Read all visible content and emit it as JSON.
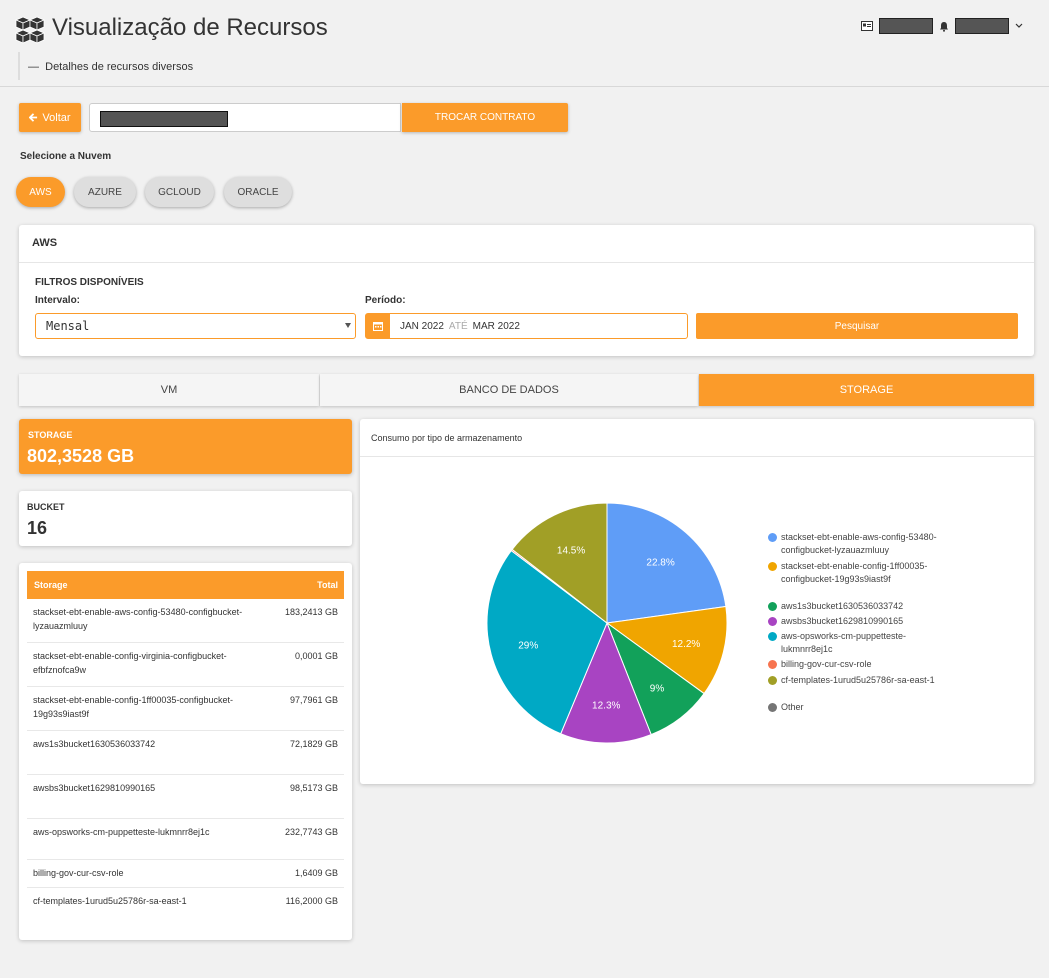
{
  "header": {
    "title": "Visualização de Recursos",
    "subtitle": "Detalhes de recursos diversos",
    "subtitle_dash": "—"
  },
  "contract": {
    "back_label": "Voltar",
    "switch_label": "TROCAR CONTRATO"
  },
  "cloud": {
    "label": "Selecione a Nuvem",
    "options": [
      "AWS",
      "AZURE",
      "GCLOUD",
      "ORACLE"
    ],
    "selected": "AWS"
  },
  "filters": {
    "card_title": "AWS",
    "section_title": "FILTROS DISPONÍVEIS",
    "interval_label": "Intervalo:",
    "interval_value": "Mensal",
    "period_label": "Período:",
    "period_start": "JAN 2022",
    "period_sep": "ATÉ",
    "period_end": "MAR 2022",
    "search_label": "Pesquisar"
  },
  "tabs": [
    "VM",
    "BANCO DE DADOS",
    "STORAGE"
  ],
  "active_tab": "STORAGE",
  "metrics": {
    "storage_label": "STORAGE",
    "storage_value": "802,3528 GB",
    "bucket_label": "BUCKET",
    "bucket_value": "16"
  },
  "table": {
    "col_storage": "Storage",
    "col_total": "Total",
    "rows": [
      {
        "name": "stackset-ebt-enable-aws-config-53480-configbucket-lyzauazmluuy",
        "total": "183,2413 GB"
      },
      {
        "name": "stackset-ebt-enable-config-virginia-configbucket-efbfznofca9w",
        "total": "0,0001 GB"
      },
      {
        "name": "stackset-ebt-enable-config-1ff00035-configbucket-19g93s9iast9f",
        "total": "97,7961 GB"
      },
      {
        "name": "aws1s3bucket1630536033742",
        "total": "72,1829 GB"
      },
      {
        "name": "awsbs3bucket1629810990165",
        "total": "98,5173 GB"
      },
      {
        "name": "aws-opsworks-cm-puppetteste-lukmnrr8ej1c",
        "total": "232,7743 GB"
      },
      {
        "name": "billing-gov-cur-csv-role",
        "total": "1,6409 GB"
      },
      {
        "name": "cf-templates-1urud5u25786r-sa-east-1",
        "total": "116,2000 GB"
      }
    ]
  },
  "chart_data": {
    "type": "pie",
    "title": "Consumo por tipo de armazenamento",
    "legend_position": "right",
    "slices": [
      {
        "label": "stackset-ebt-enable-aws-config-53480-configbucket-lyzauazmluuy",
        "value": 22.8,
        "text": "22.8%",
        "color": "#5f9df7"
      },
      {
        "label": "stackset-ebt-enable-config-1ff00035-configbucket-19g93s9iast9f",
        "value": 12.2,
        "text": "12.2%",
        "color": "#f0a500"
      },
      {
        "label": "aws1s3bucket1630536033742",
        "value": 9.0,
        "text": "9%",
        "color": "#12a15a"
      },
      {
        "label": "awsbs3bucket1629810990165",
        "value": 12.3,
        "text": "12.3%",
        "color": "#a844c2"
      },
      {
        "label": "aws-opsworks-cm-puppetteste-lukmnrr8ej1c",
        "value": 29.0,
        "text": "29%",
        "color": "#00a9c5"
      },
      {
        "label": "billing-gov-cur-csv-role",
        "value": 0.2,
        "text": "",
        "color": "#f7744f"
      },
      {
        "label": "cf-templates-1urud5u25786r-sa-east-1",
        "value": 14.5,
        "text": "14.5%",
        "color": "#a19f26"
      },
      {
        "label": "Other",
        "value": 0.0,
        "text": "",
        "color": "#757575"
      }
    ],
    "legend": [
      {
        "text": "stackset-ebt-enable-aws-config-53480-configbucket-lyzauazmluuy",
        "color": "#5f9df7"
      },
      {
        "text": "stackset-ebt-enable-config-1ff00035-configbucket-19g93s9iast9f",
        "color": "#f0a500"
      },
      {
        "text": "aws1s3bucket1630536033742",
        "color": "#12a15a"
      },
      {
        "text": "awsbs3bucket1629810990165",
        "color": "#a844c2"
      },
      {
        "text": "aws-opsworks-cm-puppetteste-lukmnrr8ej1c",
        "color": "#00a9c5"
      },
      {
        "text": "billing-gov-cur-csv-role",
        "color": "#f7744f"
      },
      {
        "text": "cf-templates-1urud5u25786r-sa-east-1",
        "color": "#a19f26"
      },
      {
        "text": "Other",
        "color": "#757575"
      }
    ]
  },
  "colors": {
    "accent": "#fb9b2a"
  }
}
